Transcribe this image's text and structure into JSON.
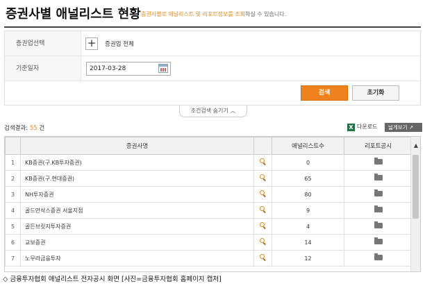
{
  "header": {
    "title": "증권사별 애널리스트 현황",
    "subtitle_highlight": "증권사별로 애널리스트 및 리포트정보를 조회",
    "subtitle_rest": "하실 수 있습니다."
  },
  "form": {
    "firm_label": "증권업선택",
    "firm_value": "증권업 전체",
    "date_label": "기준일자",
    "date_value": "2017-03-28",
    "search_label": "검색",
    "reset_label": "초기화",
    "collapse_label": "조건검색 숨기기"
  },
  "results": {
    "count_label": "검색결과:",
    "count_value": "55",
    "count_unit": "건",
    "download_label": "다운로드",
    "wide_view_label": "넓게보기"
  },
  "table": {
    "columns": [
      "증권사명",
      "애널리스트수",
      "리포트공시"
    ],
    "rows": [
      {
        "idx": "1",
        "name": "KB증권(구.KB투자증권)",
        "count": "0"
      },
      {
        "idx": "2",
        "name": "KB증권(구.현대증권)",
        "count": "65"
      },
      {
        "idx": "3",
        "name": "NH투자증권",
        "count": "80"
      },
      {
        "idx": "4",
        "name": "골드만삭스증권 서울지점",
        "count": "9"
      },
      {
        "idx": "5",
        "name": "골든브릿지투자증권",
        "count": "4"
      },
      {
        "idx": "6",
        "name": "교보증권",
        "count": "14"
      },
      {
        "idx": "7",
        "name": "노무라금융투자",
        "count": "12"
      }
    ]
  },
  "caption": "◇ 금융투자협회 애널리스트 전자공시 화면 [사진=금융투자협회 홈페이지 캡처]",
  "colors": {
    "accent": "#f0821e",
    "highlight_text": "#e88a1a"
  }
}
